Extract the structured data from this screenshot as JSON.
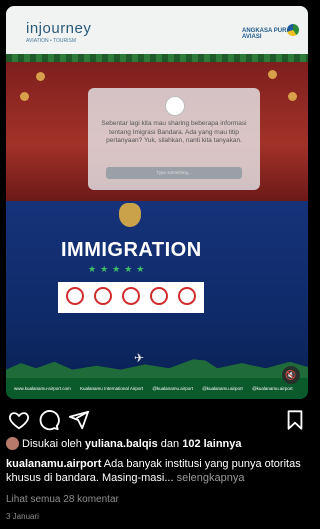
{
  "post": {
    "brand_left": "injourney",
    "brand_left_sub": "AVIATION • TOURISM",
    "brand_right": "ANGKASA PURA AVIASI",
    "popup_text": "Sebentar lagi kita mau sharing beberapa informasi tentang Imigrasi Bandara. Ada yang mau titip pertanyaan? Yuk, silahkan, nanti kita tanyakan.",
    "popup_input_placeholder": "Type something...",
    "sign_title": "IMMIGRATION",
    "sign_stars": "★★★★★",
    "footer_links": [
      "www.kualanamu-airport.com",
      "Kualanamu International Airport",
      "@kualanamu.airport",
      "@kualanamu.airport",
      "@kualanamu.airport"
    ]
  },
  "likes": {
    "prefix": "Disukai oleh ",
    "user": "yuliana.balqis",
    "middle": " dan ",
    "count": "102 lainnya"
  },
  "caption": {
    "user": "kualanamu.airport",
    "text": " Ada banyak institusi yang punya otoritas khusus di bandara. Masing-masi...",
    "more": " selengkapnya"
  },
  "comments_link": "Lihat semua 28 komentar",
  "date": "3 Januari",
  "colors": {
    "accent_green": "#3fbf6a",
    "prohibit_red": "#d12b2b"
  }
}
